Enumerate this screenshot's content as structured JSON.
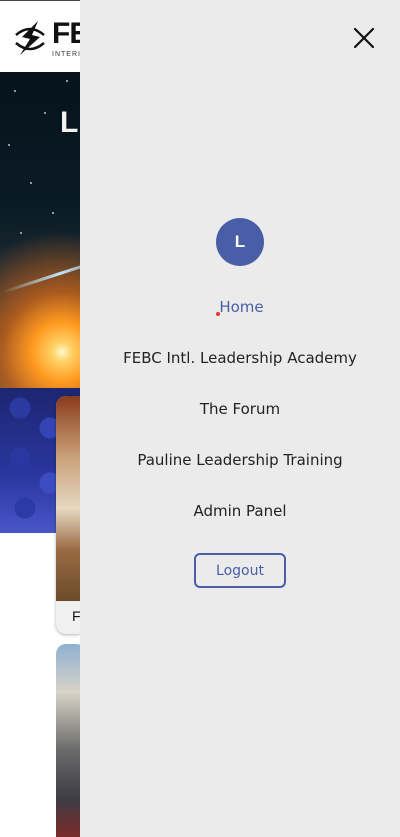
{
  "background": {
    "logo": {
      "word": "FE",
      "sub": "INTERI"
    },
    "hero_title": "L",
    "card_label": "F"
  },
  "drawer": {
    "avatar_initial": "L",
    "nav": [
      {
        "label": "Home",
        "active": true
      },
      {
        "label": "FEBC Intl. Leadership Academy",
        "active": false
      },
      {
        "label": "The Forum",
        "active": false
      },
      {
        "label": "Pauline Leadership Training",
        "active": false
      },
      {
        "label": "Admin Panel",
        "active": false
      }
    ],
    "logout_label": "Logout"
  },
  "colors": {
    "accent": "#4a5ea8",
    "drawer_bg": "#ebebeb",
    "active_dot": "#e03a2a"
  },
  "icons": {
    "close": "close-icon",
    "logo": "febc-logo-icon"
  }
}
